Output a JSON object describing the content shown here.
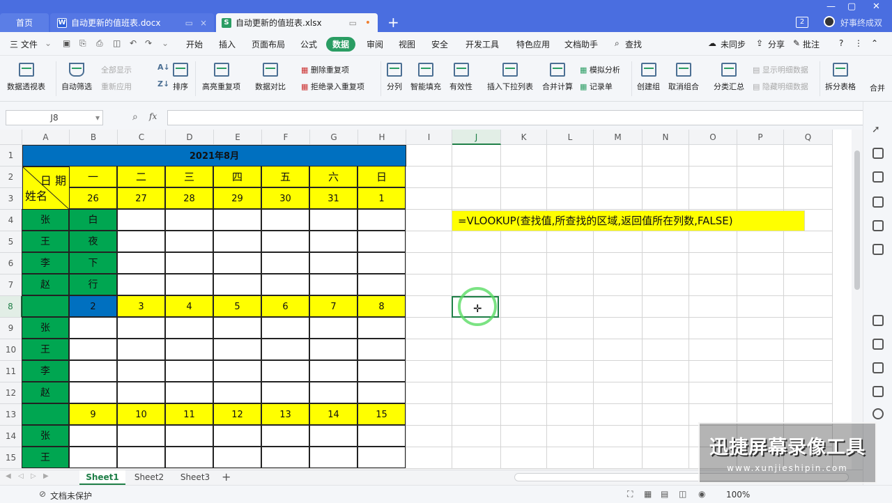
{
  "titlebar": {
    "tabs": [
      {
        "label": "首页"
      },
      {
        "label": "自动更新的值班表.docx",
        "icon": "W"
      },
      {
        "label": "自动更新的值班表.xlsx",
        "icon": "S"
      }
    ],
    "badge": "2",
    "user": "好事终成双"
  },
  "menu": {
    "file": "三 文件",
    "items": [
      "开始",
      "插入",
      "页面布局",
      "公式",
      "数据",
      "审阅",
      "视图",
      "安全",
      "开发工具",
      "特色应用",
      "文档助手"
    ],
    "active": "数据",
    "search": "查找",
    "right": [
      "未同步",
      "分享",
      "批注"
    ]
  },
  "ribbon": {
    "pivot": "数据透视表",
    "autofilter": "自动筛选",
    "showall": "全部显示",
    "reapply": "重新应用",
    "sort": "排序",
    "highlight": "高亮重复项",
    "compare": "数据对比",
    "deldup": "删除重复项",
    "rejectdup": "拒绝录入重复项",
    "split": "分列",
    "fill": "智能填充",
    "valid": "有效性",
    "dropdown": "插入下拉列表",
    "merge": "合并计算",
    "simulate": "模拟分析",
    "record": "记录单",
    "group": "创建组",
    "ungroup": "取消组合",
    "subtotal": "分类汇总",
    "showdetail": "显示明细数据",
    "hidedetail": "隐藏明细数据",
    "splittable": "拆分表格",
    "merge2": "合并"
  },
  "formula": {
    "namebox": "J8",
    "fx": "fx",
    "value": ""
  },
  "columns": [
    "A",
    "B",
    "C",
    "D",
    "E",
    "F",
    "G",
    "H",
    "I",
    "J",
    "K",
    "L",
    "M",
    "N",
    "O",
    "P",
    "Q"
  ],
  "rows": [
    "1",
    "2",
    "3",
    "4",
    "5",
    "6",
    "7",
    "8",
    "9",
    "10",
    "11",
    "12",
    "13",
    "14",
    "15"
  ],
  "sheet": {
    "title": "2021年8月",
    "date_label": "日 期",
    "name_label": "姓名",
    "weekdays": [
      "一",
      "二",
      "三",
      "四",
      "五",
      "六",
      "日"
    ],
    "week1_dates": [
      "26",
      "27",
      "28",
      "29",
      "30",
      "31",
      "1"
    ],
    "block1": [
      [
        "张",
        "白"
      ],
      [
        "王",
        "夜"
      ],
      [
        "李",
        "下"
      ],
      [
        "赵",
        "行"
      ]
    ],
    "week2_dates": [
      "2",
      "3",
      "4",
      "5",
      "6",
      "7",
      "8"
    ],
    "block2": [
      "张",
      "王",
      "李",
      "赵"
    ],
    "week3_dates": [
      "9",
      "10",
      "11",
      "12",
      "13",
      "14",
      "15"
    ],
    "block3": [
      "张",
      "王"
    ]
  },
  "annotation": "=VLOOKUP(查找值,所查找的区域,返回值所在列数,FALSE)",
  "sheets": [
    "Sheet1",
    "Sheet2",
    "Sheet3"
  ],
  "status": {
    "protect": "文档未保护",
    "zoom": "100%"
  },
  "watermark": {
    "line1": "迅捷屏幕录像工具",
    "line2": "www.xunjieshipin.com"
  },
  "colors": {
    "blue": "#0070c0",
    "yellow": "#ffff00",
    "green": "#00a651",
    "accent": "#1f7f47"
  }
}
